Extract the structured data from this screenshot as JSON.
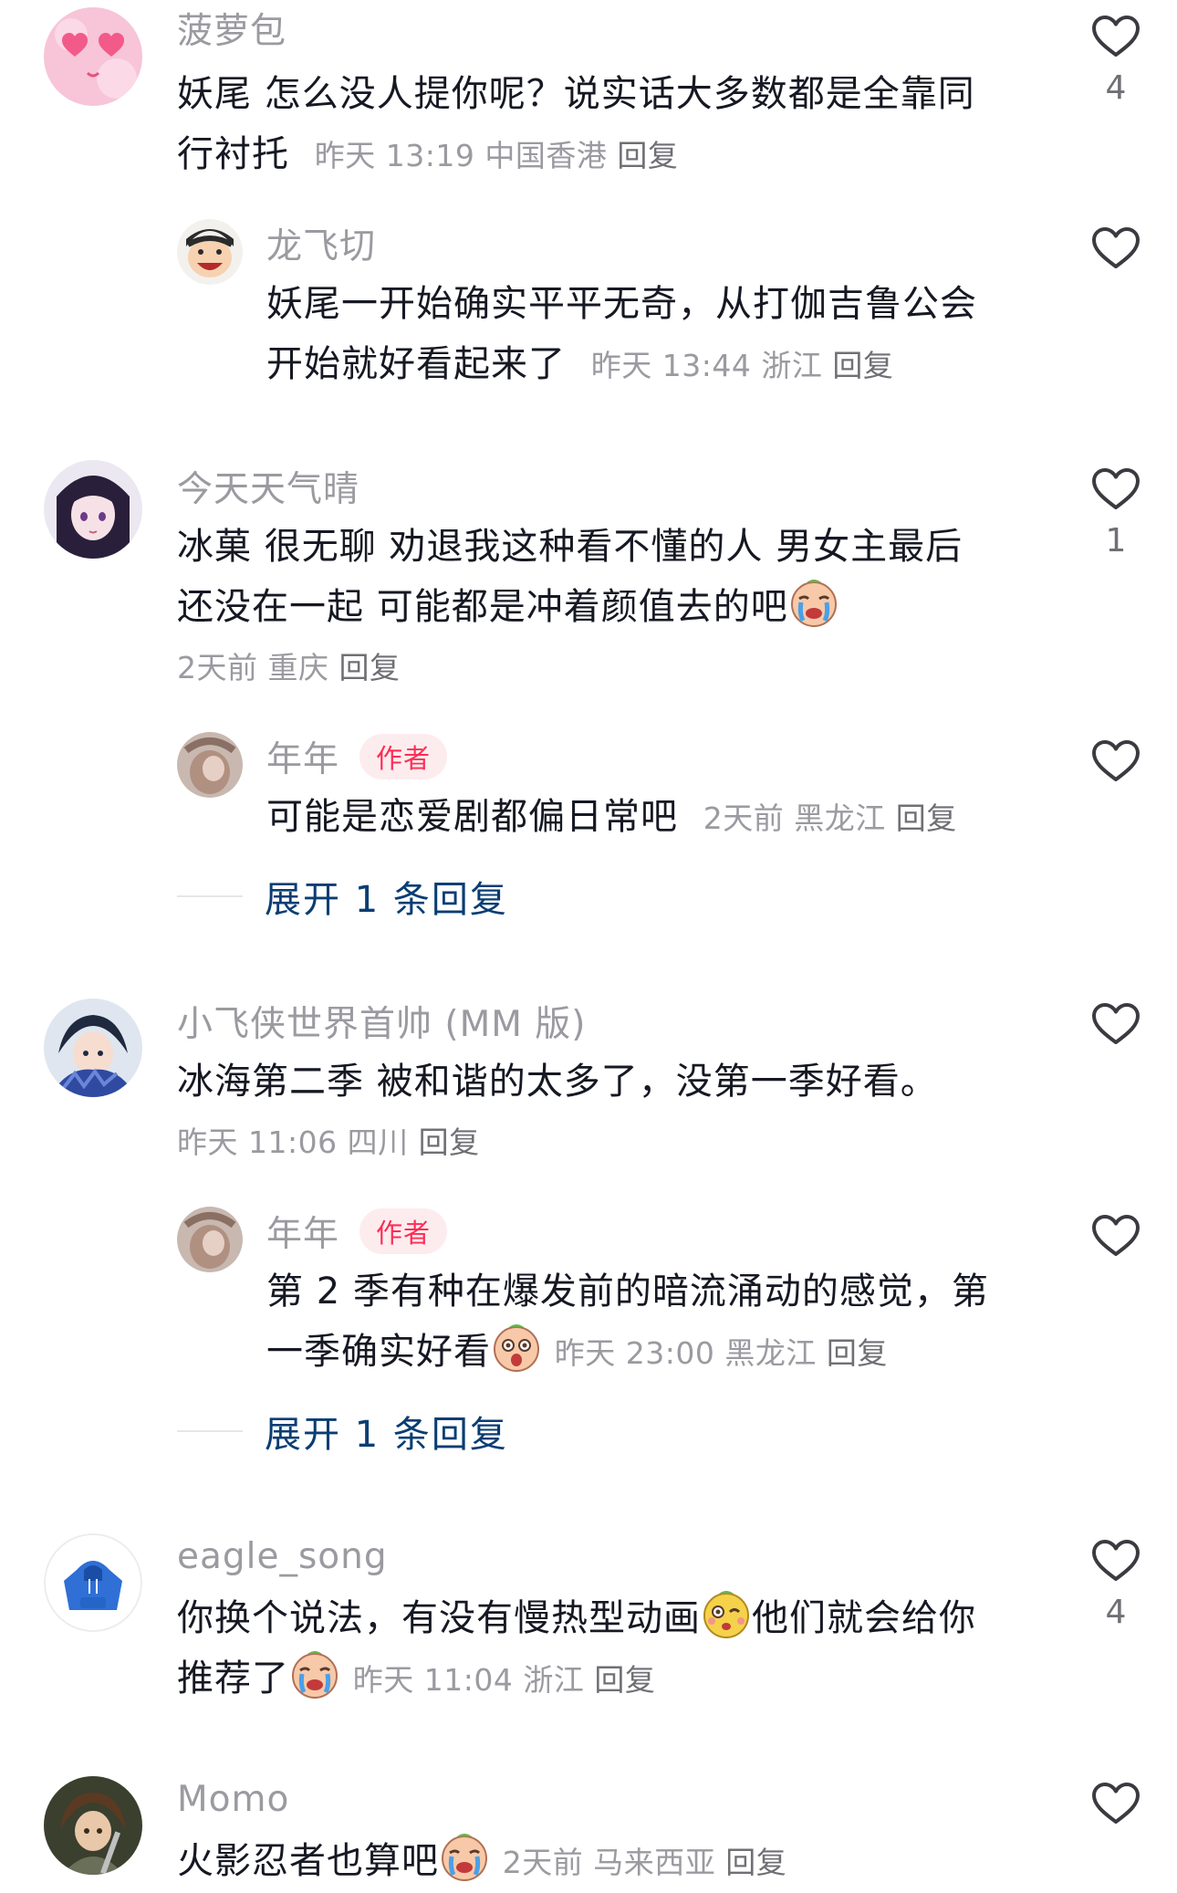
{
  "comments": [
    {
      "name": "菠萝包",
      "line1": "妖尾 怎么没人提你呢？说实话大多数都是全靠同",
      "line2": "行衬托",
      "time": "昨天 13:19",
      "location": "中国香港",
      "reply": "回复",
      "likes": "4",
      "avatar_icon": "pink-heart-avatar-icon"
    },
    {
      "name": "龙飞切",
      "line1": "妖尾一开始确实平平无奇，从打伽吉鲁公会",
      "line2": "开始就好看起来了",
      "time": "昨天 13:44",
      "location": "浙江",
      "reply": "回复",
      "likes": "",
      "avatar_icon": "laughing-cartoon-avatar-icon"
    },
    {
      "name": "今天天气晴",
      "line1": "冰菓  很无聊 劝退我这种看不懂的人 男女主最后",
      "line2": "还没在一起 可能都是冲着颜值去的吧",
      "time": "2天前",
      "location": "重庆",
      "reply": "回复",
      "likes": "1",
      "avatar_icon": "anime-girl-avatar-icon",
      "emoji_icon": "crying-face-emoji"
    },
    {
      "name": "年年",
      "badge": "作者",
      "line1": "可能是恋爱剧都偏日常吧",
      "time": "2天前",
      "location": "黑龙江",
      "reply": "回复",
      "likes": "",
      "avatar_icon": "photo-avatar-icon",
      "expand": "展开 1 条回复"
    },
    {
      "name": "小飞侠世界首帅 (MM 版)",
      "line1": "冰海第二季 被和谐的太多了，没第一季好看。",
      "time": "昨天 11:06",
      "location": "四川",
      "reply": "回复",
      "likes": "",
      "avatar_icon": "anime-boy-avatar-icon"
    },
    {
      "name": "年年",
      "badge": "作者",
      "line1": "第 2 季有种在爆发前的暗流涌动的感觉，第",
      "line2": "一季确实好看",
      "time": "昨天 23:00",
      "location": "黑龙江",
      "reply": "回复",
      "likes": "",
      "avatar_icon": "photo-avatar-icon",
      "emoji_icon": "shocked-face-emoji",
      "expand": "展开 1 条回复"
    },
    {
      "name": "eagle_song",
      "line1": "你换个说法，有没有慢热型动画",
      "line1b": "他们就会给你",
      "line2": "推荐了",
      "time": "昨天 11:04",
      "location": "浙江",
      "reply": "回复",
      "likes": "4",
      "avatar_icon": "blue-hoodie-avatar-icon",
      "emoji_icon": "wink-face-emoji",
      "emoji_icon2": "crying-face-emoji"
    },
    {
      "name": "Momo",
      "line1": "火影忍者也算吧",
      "time": "2天前",
      "location": "马来西亚",
      "reply": "回复",
      "likes": "",
      "avatar_icon": "anime-warrior-avatar-icon",
      "emoji_icon": "crying-face-emoji"
    }
  ],
  "colors": {
    "name": "#9a9aa0",
    "text": "#161823",
    "badge_bg": "#fdecee",
    "badge_text": "#fe2c55",
    "expand": "#0a3d73"
  }
}
